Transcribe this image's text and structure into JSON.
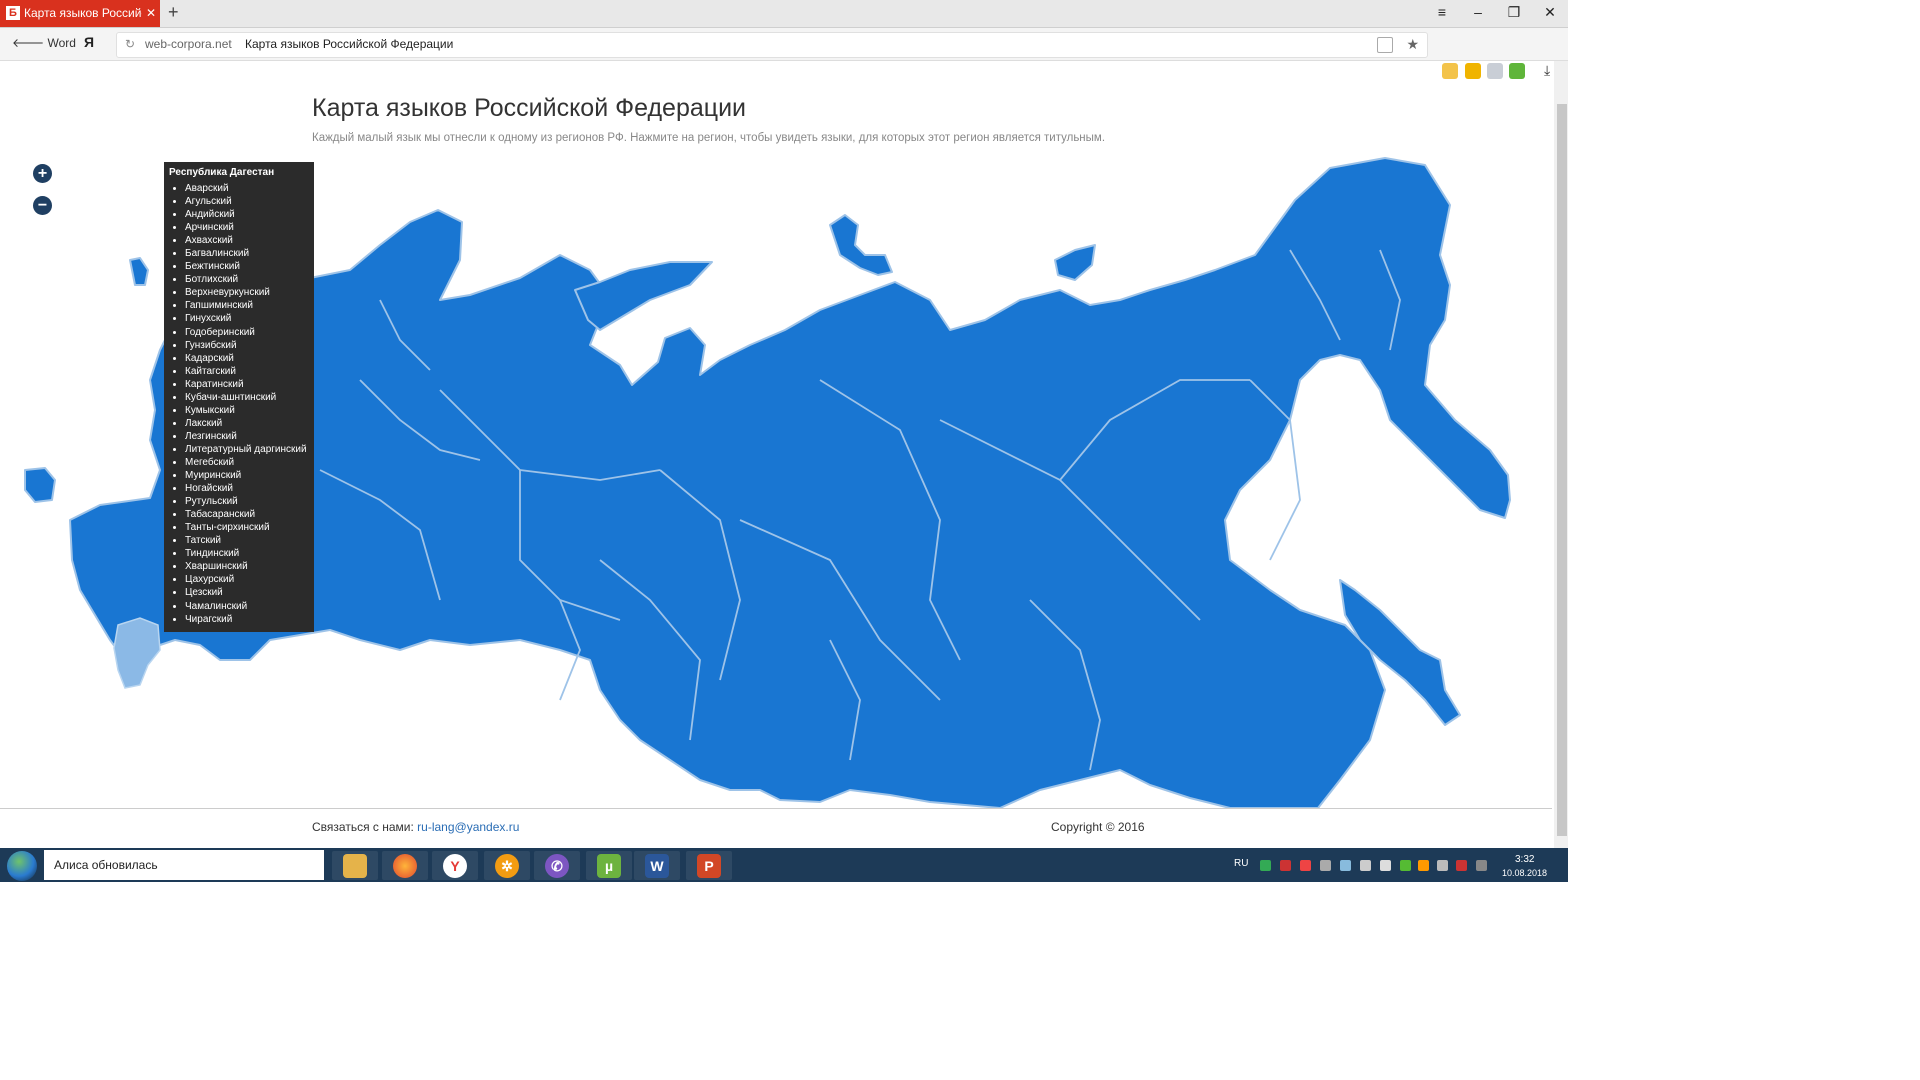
{
  "browser": {
    "tab_title": "Карта языков Российской",
    "tab_favicon": "Б",
    "back_label": "Word",
    "yandex_logo": "Я",
    "domain": "web-corpora.net",
    "page_title_in_bar": "Карта языков Российской Федерации"
  },
  "page": {
    "title": "Карта языков Российской Федерации",
    "subtitle": "Каждый малый язык мы отнесли к одному из регионов РФ. Нажмите на регион, чтобы увидеть языки, для которых этот регион является титульным.",
    "zoom_in": "+",
    "zoom_out": "−"
  },
  "tooltip": {
    "region": "Республика Дагестан",
    "languages": [
      "Аварский",
      "Агульский",
      "Андийский",
      "Арчинский",
      "Ахвахский",
      "Багвалинский",
      "Бежтинский",
      "Ботлихский",
      "Верхневуркунский",
      "Гапшиминский",
      "Гинухский",
      "Годоберинский",
      "Гунзибский",
      "Кадарский",
      "Кайтагский",
      "Каратинский",
      "Кубачи-ашнтинский",
      "Кумыкский",
      "Лакский",
      "Лезгинский",
      "Литературный даргинский",
      "Мегебский",
      "Муиринский",
      "Ногайский",
      "Рутульский",
      "Табасаранский",
      "Танты-сирхинский",
      "Татский",
      "Тиндинский",
      "Хваршинский",
      "Цахурский",
      "Цезский",
      "Чамалинский",
      "Чирагский"
    ]
  },
  "footer": {
    "contact_label": "Связаться с нами:",
    "contact_email": "ru-lang@yandex.ru",
    "copyright": "Copyright © 2016"
  },
  "taskbar": {
    "search_text": "Алиса обновилась",
    "lang": "RU",
    "time": "3:32",
    "date": "10.08.2018",
    "apps": [
      "explorer-icon",
      "firefox-icon",
      "yandex-browser-icon",
      "settings-app-icon",
      "viber-icon",
      "utorrent-icon",
      "word-icon",
      "powerpoint-icon"
    ]
  },
  "colors": {
    "map_fill": "#1976d2",
    "map_border": "#9ec3e8",
    "highlight": "#8bb9e6",
    "tab_red": "#d9311e",
    "taskbar": "#1d3a57"
  }
}
